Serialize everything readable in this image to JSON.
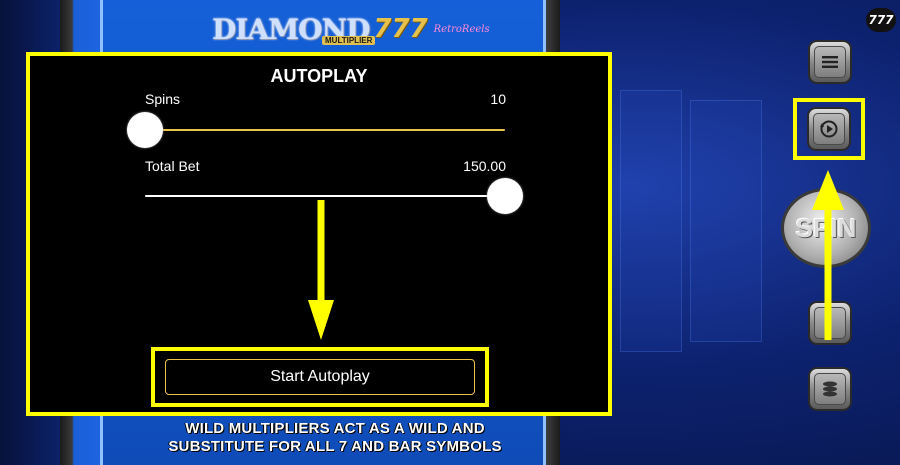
{
  "game": {
    "logo_main": "DIAMOND",
    "logo_777": "777",
    "logo_multiplier": "MULTIPLIER",
    "logo_retro": "RetroReels",
    "brand_badge": "777"
  },
  "autoplay": {
    "title": "AUTOPLAY",
    "spins": {
      "label": "Spins",
      "value": "10",
      "level": 0.0
    },
    "total_bet": {
      "label": "Total Bet",
      "value": "150.00",
      "level": 1.0
    },
    "start_label": "Start Autoplay"
  },
  "controls": {
    "menu": {
      "icon": "menu-icon"
    },
    "autoplay": {
      "icon": "autoplay-icon"
    },
    "spin": {
      "label": "SPIN",
      "icon": "spin-icon"
    },
    "bet": {
      "icon": "bet-icon"
    },
    "coins": {
      "icon": "coin-stack-icon"
    }
  },
  "banner": {
    "line1": "WILD MULTIPLIERS ACT AS A WILD AND",
    "line2": "SUBSTITUTE FOR ALL 7 AND BAR SYMBOLS"
  },
  "colors": {
    "highlight": "#ffff00",
    "slider_active": "#e8c44a",
    "slider_inactive": "#ffffff"
  }
}
